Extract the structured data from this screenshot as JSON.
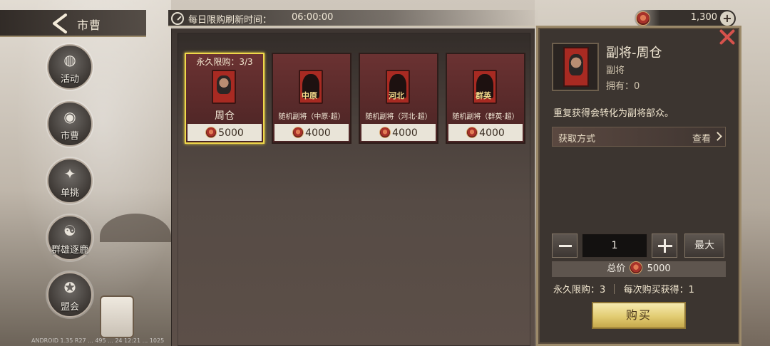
{
  "header": {
    "title": "市曹",
    "refresh_label": "每日限购刷新时间：",
    "refresh_time": "06:00:00"
  },
  "currency": {
    "amount": "1,300"
  },
  "sidebar": {
    "items": [
      {
        "label": "活动",
        "glyph": "◍"
      },
      {
        "label": "市曹",
        "glyph": "◉"
      },
      {
        "label": "单挑",
        "glyph": "✦"
      },
      {
        "label": "群雄逐鹿",
        "glyph": "☯"
      },
      {
        "label": "盟会",
        "glyph": "✪"
      }
    ]
  },
  "shop": {
    "items": [
      {
        "limit": "永久限购：3/3",
        "name": "周仓",
        "price": "5000",
        "tag": ""
      },
      {
        "limit": "",
        "name": "随机副将（中原·超）",
        "price": "4000",
        "tag": "中原"
      },
      {
        "limit": "",
        "name": "随机副将（河北·超）",
        "price": "4000",
        "tag": "河北"
      },
      {
        "limit": "",
        "name": "随机副将（群英·超）",
        "price": "4000",
        "tag": "群英"
      }
    ]
  },
  "detail": {
    "name": "副将-周仓",
    "type": "副将",
    "owned": "拥有：0",
    "description": "重复获得会转化为副将部众。",
    "acquire_label": "获取方式",
    "acquire_view": "查看",
    "quantity": "1",
    "max_label": "最大",
    "total_label": "总价",
    "total_value": "5000",
    "limit_text": "永久限购：3",
    "per_purchase_text": "每次购买获得：1",
    "buy_label": "购买"
  },
  "footer": {
    "watermark": "ANDROID 1.35 R27 ... 495 ... 24 12:21 ... 1025"
  },
  "colors": {
    "accent_gold": "#e2cc72",
    "selected_border": "#f0d84a",
    "close_red": "#d6524c",
    "card_red": "#6b3232"
  }
}
